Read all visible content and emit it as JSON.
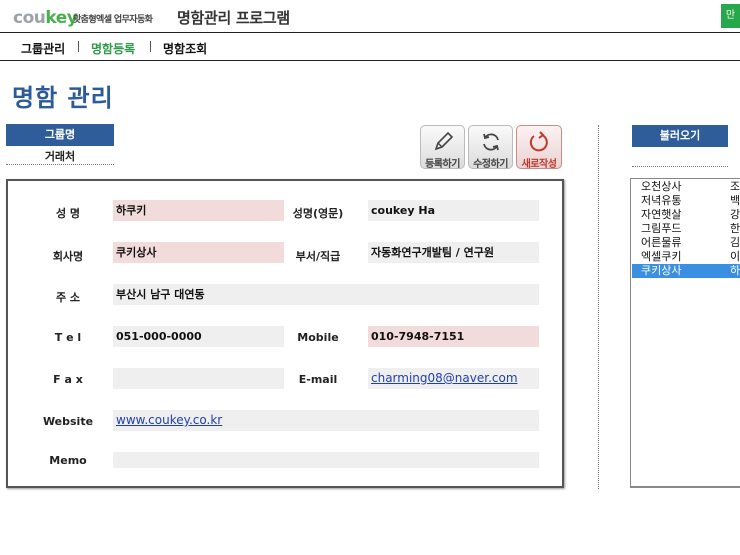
{
  "header": {
    "brand_prefix": "cou",
    "brand_suffix": "key",
    "tagline": "맞춤형엑셀 업무자동화",
    "title": "명함관리 프로그램",
    "corner_button": "만"
  },
  "nav": {
    "items": [
      {
        "label": "그룹관리",
        "color": "#111111"
      },
      {
        "label": "명함등록",
        "color": "#2e9a4a"
      },
      {
        "label": "명함조회",
        "color": "#111111"
      }
    ]
  },
  "page_title": "명함 관리",
  "group": {
    "header": "그룹명",
    "value": "거래처"
  },
  "toolbar": {
    "register": "등록하기",
    "edit": "수정하기",
    "new": "새로작성"
  },
  "form": {
    "labels": {
      "name": "성  명",
      "name_en": "성명(영문)",
      "company": "회사명",
      "dept": "부서/직급",
      "address": "주  소",
      "tel": "T e l",
      "mobile": "Mobile",
      "fax": "F a x",
      "email": "E-mail",
      "website": "Website",
      "memo": "Memo"
    },
    "values": {
      "name": "하쿠키",
      "name_en": "coukey Ha",
      "company": "쿠키상사",
      "dept": "자동화연구개발팀 / 연구원",
      "address": "부산시 남구 대연동",
      "tel": "051-000-0000",
      "mobile": "010-7948-7151",
      "fax": "",
      "email": "charming08@naver.com",
      "website": "www.coukey.co.kr",
      "memo": ""
    }
  },
  "right": {
    "load_button": "불러오기",
    "list": [
      {
        "company": "오천상사",
        "name": "조"
      },
      {
        "company": "저녁유통",
        "name": "백"
      },
      {
        "company": "자연햇살",
        "name": "강"
      },
      {
        "company": "그림푸드",
        "name": "한"
      },
      {
        "company": "어른물류",
        "name": "김"
      },
      {
        "company": "엑셀쿠키",
        "name": "이"
      },
      {
        "company": "쿠키상사",
        "name": "하",
        "selected": true
      }
    ]
  }
}
